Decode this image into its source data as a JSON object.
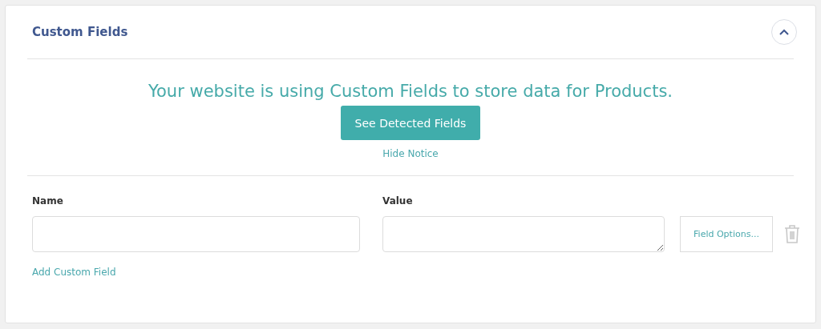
{
  "panel": {
    "title": "Custom Fields",
    "expanded": true
  },
  "notice": {
    "message": "Your website is using Custom Fields to store data for Products.",
    "button": "See Detected Fields",
    "dismiss": "Hide Notice"
  },
  "fields": {
    "name_label": "Name",
    "value_label": "Value",
    "options_button": "Field Options...",
    "add_link": "Add Custom Field"
  }
}
